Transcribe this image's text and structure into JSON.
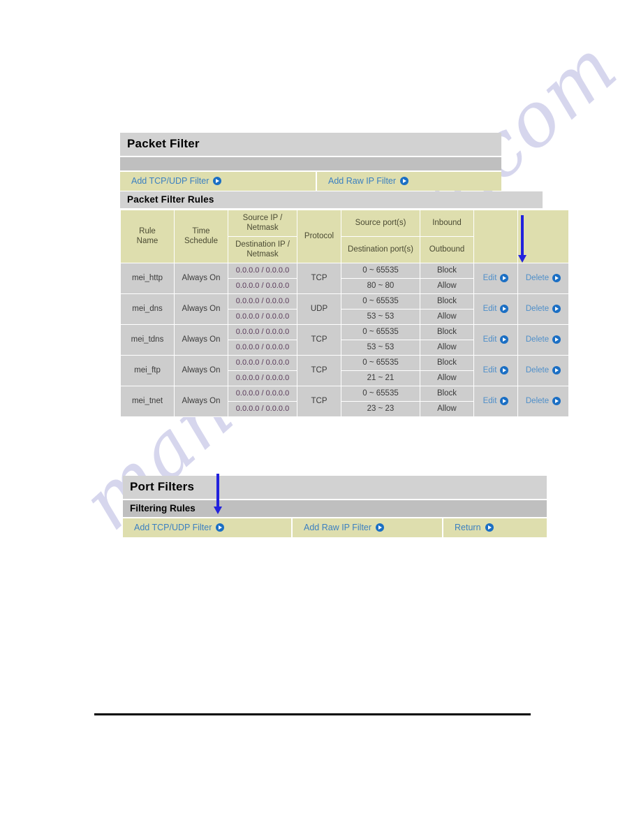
{
  "watermark": {
    "text": "manualshive.com",
    "color": "#c9c9e8"
  },
  "packet_filter": {
    "title": "Packet Filter",
    "actions": [
      {
        "label": "Add TCP/UDP Filter",
        "icon": "go-icon"
      },
      {
        "label": "Add Raw IP Filter",
        "icon": "go-icon"
      }
    ]
  },
  "rules": {
    "title": "Packet Filter Rules",
    "headers": {
      "rule_name": "Rule\nName",
      "rule_name_line1": "Rule",
      "rule_name_line2": "Name",
      "time_schedule_line1": "Time",
      "time_schedule_line2": "Schedule",
      "source_ip": "Source IP /",
      "source_netmask": "Netmask",
      "destination_ip": "Destination IP /",
      "destination_netmask": "Netmask",
      "protocol": "Protocol",
      "source_ports": "Source port(s)",
      "destination_ports": "Destination port(s)",
      "inbound": "Inbound",
      "outbound": "Outbound"
    },
    "edit_label": "Edit",
    "delete_label": "Delete",
    "rows": [
      {
        "name": "mei_http",
        "schedule": "Always On",
        "source_ip": "0.0.0.0 / 0.0.0.0",
        "destination_ip": "0.0.0.0 / 0.0.0.0",
        "protocol": "TCP",
        "source_port": "0 ~ 65535",
        "destination_port": "80 ~ 80",
        "inbound": "Block",
        "outbound": "Allow"
      },
      {
        "name": "mei_dns",
        "schedule": "Always On",
        "source_ip": "0.0.0.0 / 0.0.0.0",
        "destination_ip": "0.0.0.0 / 0.0.0.0",
        "protocol": "UDP",
        "source_port": "0 ~ 65535",
        "destination_port": "53 ~ 53",
        "inbound": "Block",
        "outbound": "Allow"
      },
      {
        "name": "mei_tdns",
        "schedule": "Always On",
        "source_ip": "0.0.0.0 / 0.0.0.0",
        "destination_ip": "0.0.0.0 / 0.0.0.0",
        "protocol": "TCP",
        "source_port": "0 ~ 65535",
        "destination_port": "53 ~ 53",
        "inbound": "Block",
        "outbound": "Allow"
      },
      {
        "name": "mei_ftp",
        "schedule": "Always On",
        "source_ip": "0.0.0.0 / 0.0.0.0",
        "destination_ip": "0.0.0.0 / 0.0.0.0",
        "protocol": "TCP",
        "source_port": "0 ~ 65535",
        "destination_port": "21 ~ 21",
        "inbound": "Block",
        "outbound": "Allow"
      },
      {
        "name": "mei_tnet",
        "schedule": "Always On",
        "source_ip": "0.0.0.0 / 0.0.0.0",
        "destination_ip": "0.0.0.0 / 0.0.0.0",
        "protocol": "TCP",
        "source_port": "0 ~ 65535",
        "destination_port": "23 ~ 23",
        "inbound": "Block",
        "outbound": "Allow"
      }
    ]
  },
  "port_filters": {
    "title": "Port Filters",
    "subtitle": "Filtering Rules",
    "actions": [
      {
        "label": "Add TCP/UDP Filter",
        "icon": "go-icon"
      },
      {
        "label": "Add Raw IP Filter",
        "icon": "go-icon"
      },
      {
        "label": "Return",
        "icon": "go-icon"
      }
    ]
  },
  "annotations": {
    "arrow_color": "#2222dd",
    "arrow_delete_target": "Delete",
    "arrow_filtering_target": "Filtering Rules"
  }
}
